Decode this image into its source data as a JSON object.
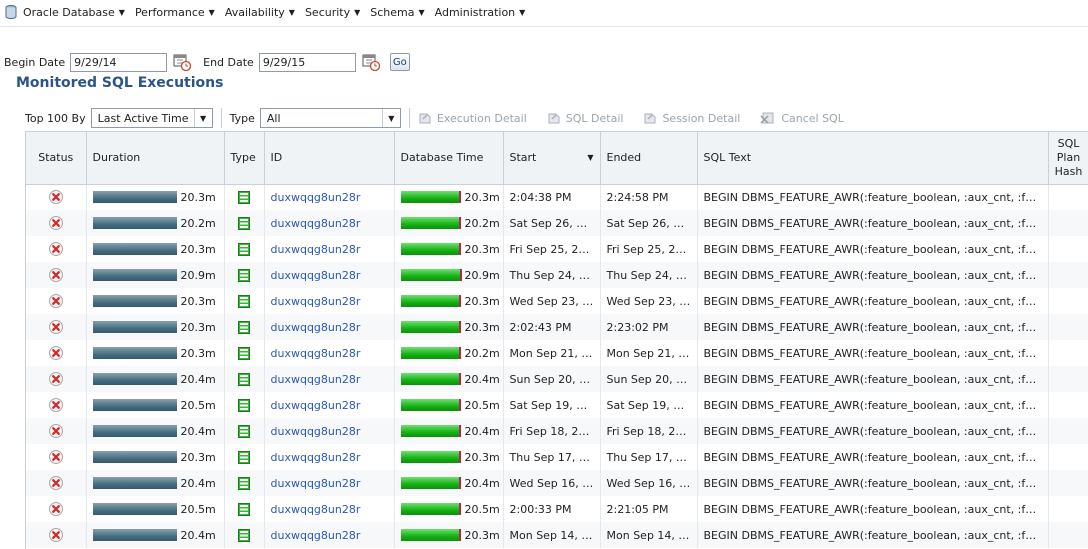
{
  "menu": {
    "items": [
      {
        "label": "Oracle Database"
      },
      {
        "label": "Performance"
      },
      {
        "label": "Availability"
      },
      {
        "label": "Security"
      },
      {
        "label": "Schema"
      },
      {
        "label": "Administration"
      }
    ]
  },
  "filters": {
    "begin_label": "Begin Date",
    "begin_value": "9/29/14",
    "end_label": "End Date",
    "end_value": "9/29/15",
    "go_label": "Go"
  },
  "section": {
    "title": "Monitored SQL Executions"
  },
  "toolbar": {
    "top_label": "Top 100 By",
    "top_selected": "Last Active Time",
    "type_label": "Type",
    "type_selected": "All",
    "execution_detail": "Execution Detail",
    "sql_detail": "SQL Detail",
    "session_detail": "Session Detail",
    "cancel_sql": "Cancel SQL"
  },
  "table": {
    "headers": {
      "status": "Status",
      "duration": "Duration",
      "type": "Type",
      "id": "ID",
      "db_time": "Database Time",
      "start": "Start",
      "ended": "Ended",
      "sql_text": "SQL Text",
      "plan_hash_line1": "SQL",
      "plan_hash_line2": "Plan",
      "plan_hash_line3": "Hash"
    },
    "rows": [
      {
        "duration": "20.3m",
        "duration_frac": 1.0,
        "id": "duxwqqg8un28r",
        "db_time": "20.3m",
        "db_frac": 0.97,
        "start": "2:04:38 PM",
        "ended": "2:24:58 PM",
        "sql": "BEGIN DBMS_FEATURE_AWR(:feature_boolean, :aux_cnt, :feature..."
      },
      {
        "duration": "20.2m",
        "duration_frac": 1.0,
        "id": "duxwqqg8un28r",
        "db_time": "20.2m",
        "db_frac": 0.97,
        "start": "Sat Sep 26, 20...",
        "ended": "Sat Sep 26, 20...",
        "sql": "BEGIN DBMS_FEATURE_AWR(:feature_boolean, :aux_cnt, :feature..."
      },
      {
        "duration": "20.3m",
        "duration_frac": 1.0,
        "id": "duxwqqg8un28r",
        "db_time": "20.3m",
        "db_frac": 0.97,
        "start": "Fri Sep 25, 201...",
        "ended": "Fri Sep 25, 201...",
        "sql": "BEGIN DBMS_FEATURE_AWR(:feature_boolean, :aux_cnt, :feature..."
      },
      {
        "duration": "20.9m",
        "duration_frac": 1.0,
        "id": "duxwqqg8un28r",
        "db_time": "20.9m",
        "db_frac": 0.98,
        "start": "Thu Sep 24, 20...",
        "ended": "Thu Sep 24, 20...",
        "sql": "BEGIN DBMS_FEATURE_AWR(:feature_boolean, :aux_cnt, :feature..."
      },
      {
        "duration": "20.3m",
        "duration_frac": 1.0,
        "id": "duxwqqg8un28r",
        "db_time": "20.3m",
        "db_frac": 0.97,
        "start": "Wed Sep 23, 2...",
        "ended": "Wed Sep 23, 2...",
        "sql": "BEGIN DBMS_FEATURE_AWR(:feature_boolean, :aux_cnt, :feature..."
      },
      {
        "duration": "20.3m",
        "duration_frac": 1.0,
        "id": "duxwqqg8un28r",
        "db_time": "20.3m",
        "db_frac": 0.97,
        "start": "2:02:43 PM",
        "ended": "2:23:02 PM",
        "sql": "BEGIN DBMS_FEATURE_AWR(:feature_boolean, :aux_cnt, :feature..."
      },
      {
        "duration": "20.3m",
        "duration_frac": 1.0,
        "id": "duxwqqg8un28r",
        "db_time": "20.2m",
        "db_frac": 0.97,
        "start": "Mon Sep 21, 20...",
        "ended": "Mon Sep 21, 20...",
        "sql": "BEGIN DBMS_FEATURE_AWR(:feature_boolean, :aux_cnt, :feature..."
      },
      {
        "duration": "20.4m",
        "duration_frac": 1.0,
        "id": "duxwqqg8un28r",
        "db_time": "20.4m",
        "db_frac": 0.97,
        "start": "Sun Sep 20, 20...",
        "ended": "Sun Sep 20, 20...",
        "sql": "BEGIN DBMS_FEATURE_AWR(:feature_boolean, :aux_cnt, :feature..."
      },
      {
        "duration": "20.5m",
        "duration_frac": 1.0,
        "id": "duxwqqg8un28r",
        "db_time": "20.5m",
        "db_frac": 0.97,
        "start": "Sat Sep 19, 20...",
        "ended": "Sat Sep 19, 20...",
        "sql": "BEGIN DBMS_FEATURE_AWR(:feature_boolean, :aux_cnt, :feature..."
      },
      {
        "duration": "20.4m",
        "duration_frac": 1.0,
        "id": "duxwqqg8un28r",
        "db_time": "20.4m",
        "db_frac": 0.97,
        "start": "Fri Sep 18, 201...",
        "ended": "Fri Sep 18, 201...",
        "sql": "BEGIN DBMS_FEATURE_AWR(:feature_boolean, :aux_cnt, :feature..."
      },
      {
        "duration": "20.3m",
        "duration_frac": 1.0,
        "id": "duxwqqg8un28r",
        "db_time": "20.3m",
        "db_frac": 0.97,
        "start": "Thu Sep 17, 20...",
        "ended": "Thu Sep 17, 20...",
        "sql": "BEGIN DBMS_FEATURE_AWR(:feature_boolean, :aux_cnt, :feature..."
      },
      {
        "duration": "20.4m",
        "duration_frac": 1.0,
        "id": "duxwqqg8un28r",
        "db_time": "20.4m",
        "db_frac": 0.97,
        "start": "Wed Sep 16, 2...",
        "ended": "Wed Sep 16, 2...",
        "sql": "BEGIN DBMS_FEATURE_AWR(:feature_boolean, :aux_cnt, :feature..."
      },
      {
        "duration": "20.5m",
        "duration_frac": 1.0,
        "id": "duxwqqg8un28r",
        "db_time": "20.5m",
        "db_frac": 0.97,
        "start": "2:00:33 PM",
        "ended": "2:21:05 PM",
        "sql": "BEGIN DBMS_FEATURE_AWR(:feature_boolean, :aux_cnt, :feature..."
      },
      {
        "duration": "20.4m",
        "duration_frac": 1.0,
        "id": "duxwqqg8un28r",
        "db_time": "20.3m",
        "db_frac": 0.97,
        "start": "Mon Sep 14, 20...",
        "ended": "Mon Sep 14, 20...",
        "sql": "BEGIN DBMS_FEATURE_AWR(:feature_boolean, :aux_cnt, :feature..."
      }
    ]
  },
  "colors": {
    "title": "#2c5587",
    "link": "#2a59b4",
    "db_time_bar": "#16b116",
    "duration_bar": "#466f80",
    "status_error": "#d42a2a"
  },
  "icons": {
    "status": "error-x-icon",
    "type": "sql-type-icon",
    "calendar": "calendar-icon",
    "database": "database-icon"
  }
}
